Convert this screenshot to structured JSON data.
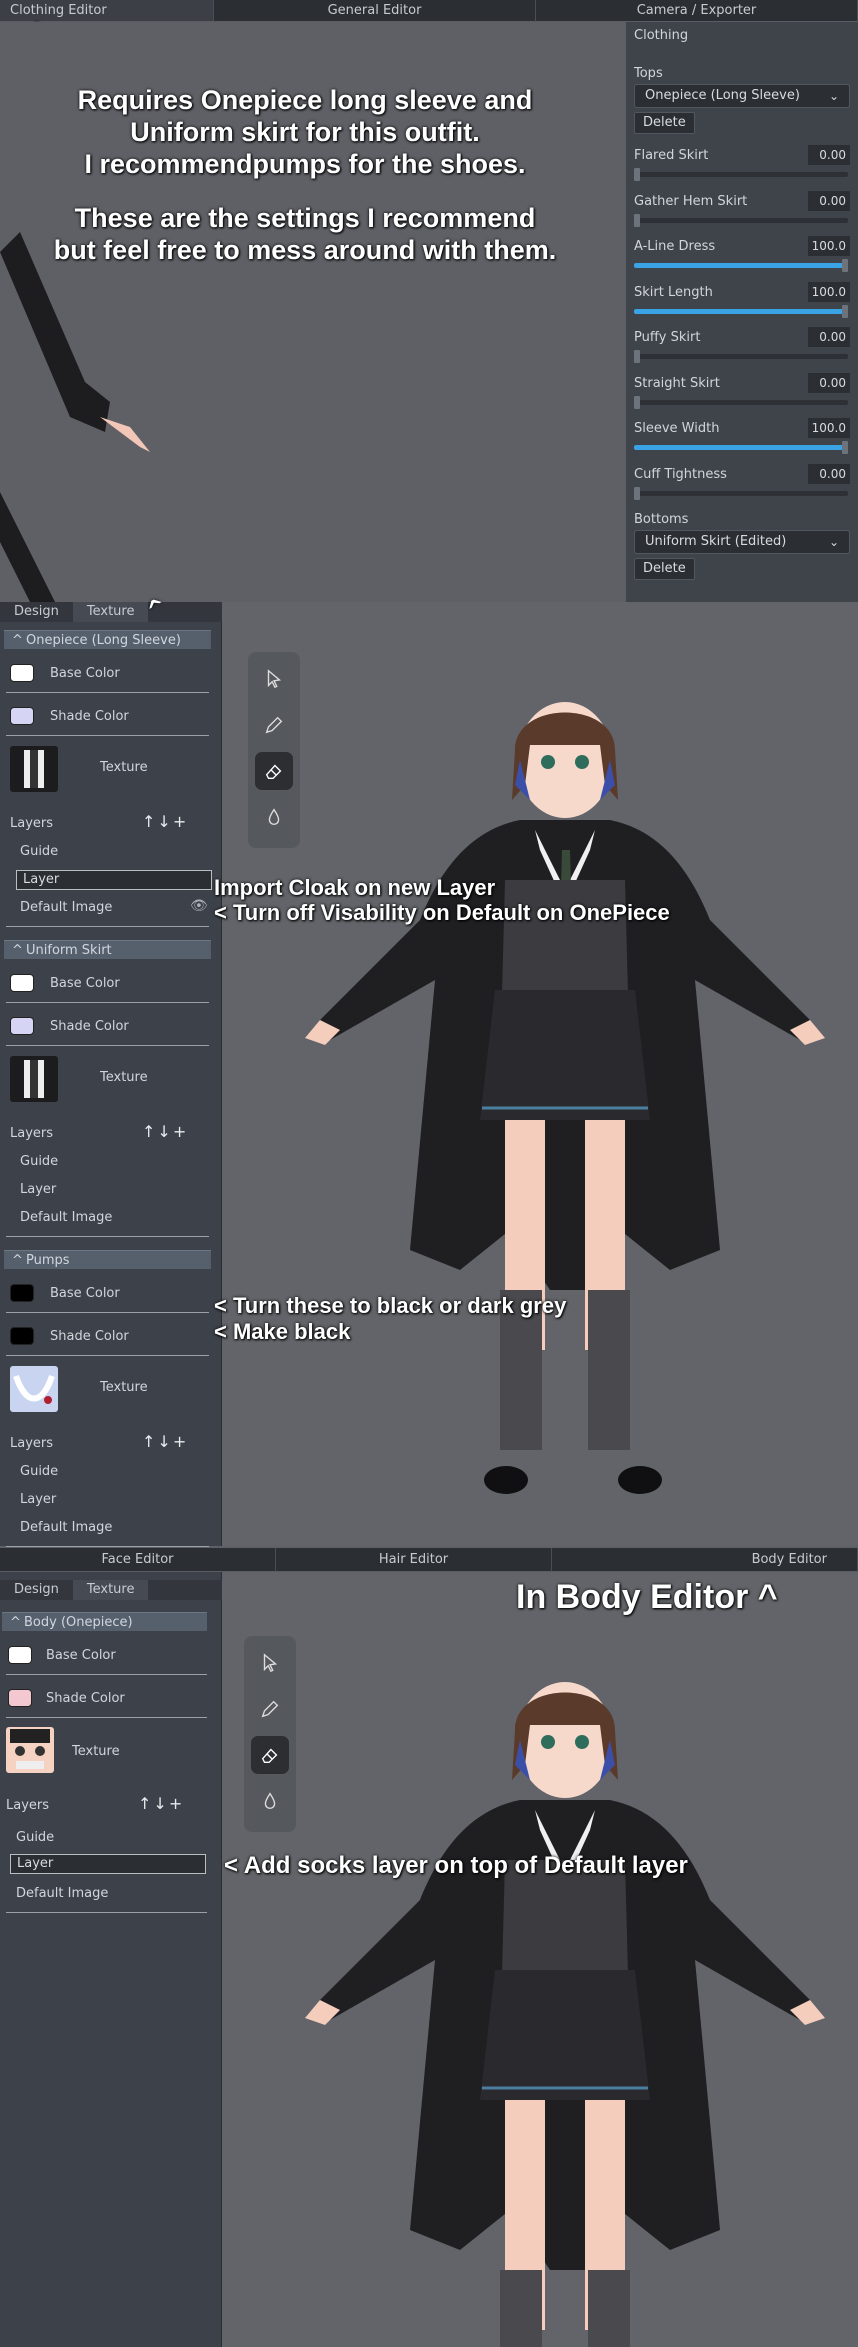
{
  "top_editor_tabs": [
    "Clothing Editor",
    "General Editor",
    "Camera / Exporter"
  ],
  "instructions": {
    "line1": "Requires Onepiece long sleeve and",
    "line2": "Uniform skirt for this outfit.",
    "line3": "I recommendpumps for the shoes.",
    "line4": "These are the settings I recommend",
    "line5": "but feel free to mess around with them."
  },
  "clothing_panel": {
    "title": "Clothing",
    "tops_label": "Tops",
    "tops_value": "Onepiece (Long Sleeve)",
    "delete": "Delete",
    "sliders": [
      {
        "label": "Flared Skirt",
        "value": "0.00",
        "level": 0
      },
      {
        "label": "Gather Hem Skirt",
        "value": "0.00",
        "level": 0
      },
      {
        "label": "A-Line Dress",
        "value": "100.0",
        "level": 1
      },
      {
        "label": "Skirt Length",
        "value": "100.0",
        "level": 1
      },
      {
        "label": "Puffy Skirt",
        "value": "0.00",
        "level": 0
      },
      {
        "label": "Straight Skirt",
        "value": "0.00",
        "level": 0
      },
      {
        "label": "Sleeve Width",
        "value": "100.0",
        "level": 1
      },
      {
        "label": "Cuff Tightness",
        "value": "0.00",
        "level": 0
      }
    ],
    "bottoms_label": "Bottoms",
    "bottoms_value": "Uniform Skirt (Edited)",
    "delete2": "Delete"
  },
  "texture_panel": {
    "tabs": [
      "Design",
      "Texture"
    ],
    "sections": [
      {
        "name": "Onepiece (Long Sleeve)",
        "base": "Base Color",
        "shade": "Shade Color",
        "texture": "Texture",
        "layers": "Layers",
        "items": [
          "Guide",
          "Layer",
          "Default Image"
        ],
        "base_color": "#ffffff",
        "shade_color": "#d6d4f4"
      },
      {
        "name": "Uniform Skirt",
        "base": "Base Color",
        "shade": "Shade Color",
        "texture": "Texture",
        "layers": "Layers",
        "items": [
          "Guide",
          "Layer",
          "Default Image"
        ],
        "base_color": "#ffffff",
        "shade_color": "#d6d4f4"
      },
      {
        "name": "Pumps",
        "base": "Base Color",
        "shade": "Shade Color",
        "texture": "Texture",
        "layers": "Layers",
        "items": [
          "Guide",
          "Layer",
          "Default Image"
        ],
        "base_color": "#000000",
        "shade_color": "#000000"
      }
    ]
  },
  "notes": {
    "import": "Import Cloak on new Layer",
    "visibility": "< Turn off Visability on Default on OnePiece",
    "black": "< Turn these to black or dark grey",
    "make_black": "< Make black",
    "body_editor": "In Body Editor ^",
    "socks": "< Add socks layer on top of Default layer"
  },
  "bottom_editor_tabs": [
    "Face Editor",
    "Hair Editor",
    "Body Editor"
  ],
  "body_panel": {
    "tabs": [
      "Design",
      "Texture"
    ],
    "name": "Body (Onepiece)",
    "base": "Base Color",
    "shade": "Shade Color",
    "texture": "Texture",
    "layers": "Layers",
    "items": [
      "Guide",
      "Layer",
      "Default Image"
    ],
    "base_color": "#ffffff",
    "shade_color": "#f4c8d0"
  },
  "arrow_glyph": "^"
}
